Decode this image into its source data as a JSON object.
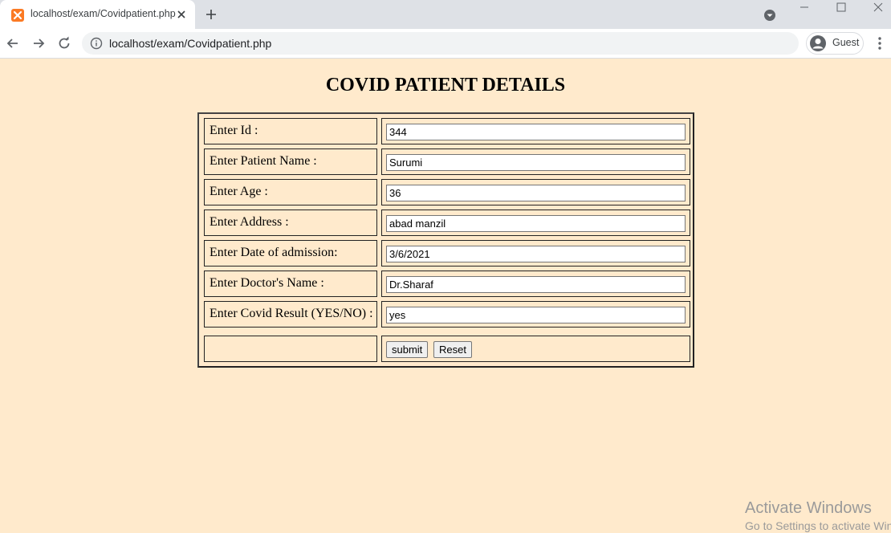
{
  "browser": {
    "tab_title": "localhost/exam/Covidpatient.php",
    "url": "localhost/exam/Covidpatient.php",
    "profile_label": "Guest"
  },
  "page": {
    "heading": "COVID PATIENT DETAILS"
  },
  "form": {
    "rows": [
      {
        "label": "Enter Id :",
        "value": "344"
      },
      {
        "label": "Enter Patient Name :",
        "value": "Surumi"
      },
      {
        "label": "Enter Age :",
        "value": "36"
      },
      {
        "label": "Enter Address :",
        "value": "abad manzil"
      },
      {
        "label": "Enter Date of admission:",
        "value": "3/6/2021"
      },
      {
        "label": "Enter Doctor's Name :",
        "value": "Dr.Sharaf"
      },
      {
        "label": "Enter Covid Result (YES/NO) :",
        "value": "yes"
      }
    ],
    "submit_label": "submit",
    "reset_label": "Reset"
  },
  "watermark": {
    "line1": "Activate Windows",
    "line2": "Go to Settings to activate Windows."
  },
  "colors": {
    "page_background": "#ffeacc",
    "favicon": "#fb7a24"
  }
}
